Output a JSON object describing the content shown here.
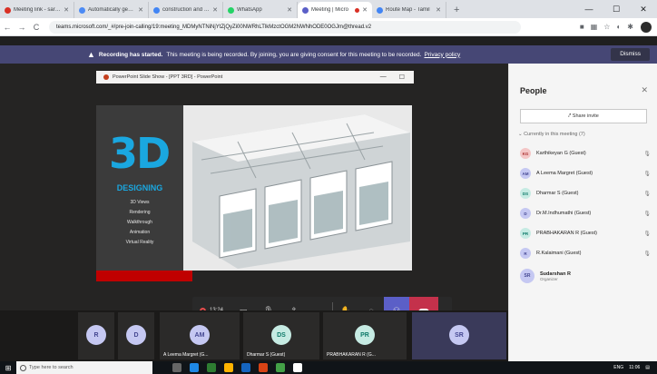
{
  "browser": {
    "tabs": [
      {
        "label": "Meeting link - sarithi",
        "favicon_color": "#d93025"
      },
      {
        "label": "Automatically generate",
        "favicon_color": "#4c8bf5"
      },
      {
        "label": "construction and bui",
        "favicon_color": "#4285f4"
      },
      {
        "label": "WhatsApp",
        "favicon_color": "#25d366"
      },
      {
        "label": "Meeting | Micro",
        "favicon_color": "#5b5fc7",
        "active": true,
        "recording": true
      },
      {
        "label": "Route Map - Tamil",
        "favicon_color": "#4285f4"
      }
    ],
    "url": "teams.microsoft.com/_#/pre-join-calling/19:meeting_MDMyNTNiNjYtZjQyZi00NWRhLTlkMzctOGM2NWNhODE0OGJm@thread.v2"
  },
  "banner": {
    "strong": "Recording has started.",
    "text": "This meeting is being recorded. By joining, you are giving consent for this meeting to be recorded.",
    "link": "Privacy policy",
    "dismiss": "Dismiss"
  },
  "shared_window": {
    "title": "PowerPoint Slide Show - [PPT 3RD] - PowerPoint"
  },
  "slide": {
    "headline": "3D",
    "subtitle": "DESIGNING",
    "services": [
      "3D Views",
      "Rendering",
      "Walkthrough",
      "Animation",
      "Virtual Reality"
    ]
  },
  "controls": {
    "timer": "13:24"
  },
  "participants_strip": [
    {
      "initials": "R",
      "name": "",
      "bg": "#c5c8f2",
      "fg": "#444791"
    },
    {
      "initials": "D",
      "name": "",
      "bg": "#c5c8f2",
      "fg": "#444791"
    },
    {
      "initials": "AM",
      "name": "A Leema Margret (G...",
      "bg": "#c5c8f2",
      "fg": "#444791"
    },
    {
      "initials": "DS",
      "name": "Dharmar S (Guest)",
      "bg": "#c6ebe3",
      "fg": "#0f7a6a"
    },
    {
      "initials": "PR",
      "name": "PRABHAKARAN R (G...",
      "bg": "#c6ebe3",
      "fg": "#0f7a6a"
    },
    {
      "initials": "SR",
      "name": "",
      "bg": "#c5c8f2",
      "fg": "#444791"
    }
  ],
  "people_panel": {
    "title": "People",
    "share_invite": "Share invite",
    "currently": "Currently in this meeting (7)",
    "members": [
      {
        "initials": "KG",
        "name": "Karthikeyan G (Guest)",
        "bg": "#f4c6c6",
        "fg": "#a33"
      },
      {
        "initials": "AM",
        "name": "A Leema Margret (Guest)",
        "bg": "#c5c8f2",
        "fg": "#444791"
      },
      {
        "initials": "DS",
        "name": "Dharmar S (Guest)",
        "bg": "#c6ebe3",
        "fg": "#0f7a6a"
      },
      {
        "initials": "D",
        "name": "Dr.M.Indhumathi (Guest)",
        "bg": "#c5c8f2",
        "fg": "#444791"
      },
      {
        "initials": "PR",
        "name": "PRABHAKARAN R (Guest)",
        "bg": "#c6ebe3",
        "fg": "#0f7a6a"
      },
      {
        "initials": "R",
        "name": "R.Kalaimani (Guest)",
        "bg": "#c5c8f2",
        "fg": "#444791"
      }
    ],
    "organizer": {
      "initials": "SR",
      "name": "Sudarshan R",
      "role": "Organizer"
    }
  },
  "taskbar": {
    "search_placeholder": "Type here to search",
    "time": "11:06",
    "lang": "ENG"
  }
}
